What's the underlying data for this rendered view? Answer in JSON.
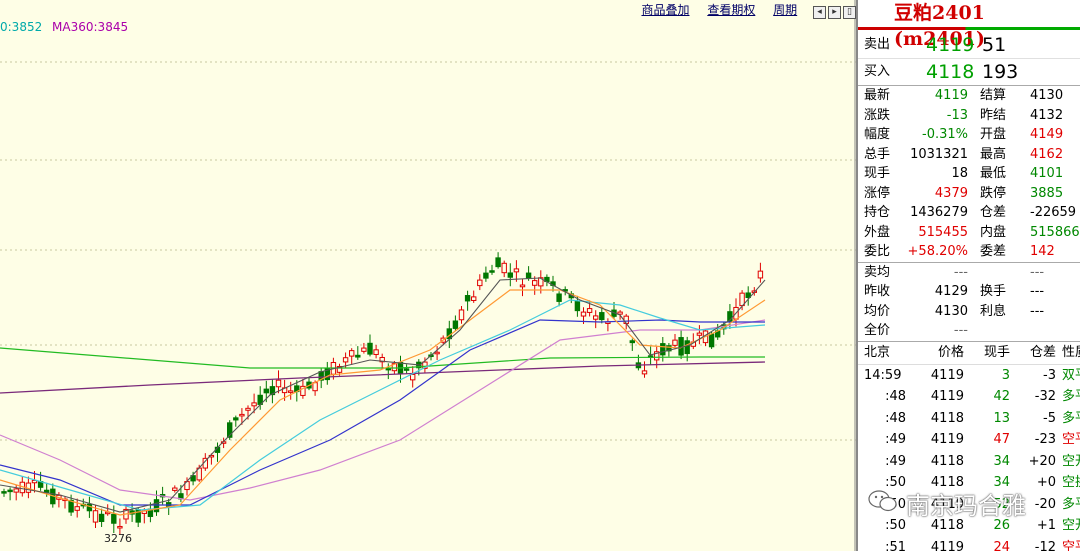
{
  "ma_legend": [
    {
      "text": "0:3852",
      "color": "#00aaaa"
    },
    {
      "text": "MA360:3845",
      "color": "#aa00aa"
    }
  ],
  "toolbar": {
    "overlay_label": "商品叠加",
    "rights_label": "查看期权",
    "period_label": "周期"
  },
  "chart_low_label": "3276",
  "panel": {
    "title": "豆粕2401 (m2401)",
    "sell": {
      "label": "卖出",
      "price": "4119",
      "volume": "51"
    },
    "buy": {
      "label": "买入",
      "price": "4118",
      "volume": "193"
    },
    "stats": [
      {
        "k1": "最新",
        "v1": "4119",
        "c1": "green",
        "k2": "结算",
        "v2": "4130",
        "c2": "black"
      },
      {
        "k1": "涨跌",
        "v1": "-13",
        "c1": "green",
        "k2": "昨结",
        "v2": "4132",
        "c2": "black"
      },
      {
        "k1": "幅度",
        "v1": "-0.31%",
        "c1": "green",
        "k2": "开盘",
        "v2": "4149",
        "c2": "red"
      },
      {
        "k1": "总手",
        "v1": "1031321",
        "c1": "black",
        "k2": "最高",
        "v2": "4162",
        "c2": "red"
      },
      {
        "k1": "现手",
        "v1": "18",
        "c1": "black",
        "k2": "最低",
        "v2": "4101",
        "c2": "green"
      },
      {
        "k1": "涨停",
        "v1": "4379",
        "c1": "red",
        "k2": "跌停",
        "v2": "3885",
        "c2": "green"
      },
      {
        "k1": "持仓",
        "v1": "1436279",
        "c1": "black",
        "k2": "仓差",
        "v2": "-22659",
        "c2": "black"
      },
      {
        "k1": "外盘",
        "v1": "515455",
        "c1": "red",
        "k2": "内盘",
        "v2": "515866",
        "c2": "green"
      },
      {
        "k1": "委比",
        "v1": "+58.20%",
        "c1": "red",
        "k2": "委差",
        "v2": "142",
        "c2": "red"
      }
    ],
    "stats2": [
      {
        "k1": "卖均",
        "v1": "---",
        "c1": "gray",
        "k2": "",
        "v2": "---",
        "c2": "gray"
      },
      {
        "k1": "昨收",
        "v1": "4129",
        "c1": "black",
        "k2": "换手",
        "v2": "---",
        "c2": "black"
      },
      {
        "k1": "均价",
        "v1": "4130",
        "c1": "black",
        "k2": "利息",
        "v2": "---",
        "c2": "black"
      },
      {
        "k1": "全价",
        "v1": "---",
        "c1": "gray",
        "k2": "",
        "v2": "",
        "c2": "black"
      }
    ],
    "tick_header": {
      "time": "北京",
      "price": "价格",
      "vol": "现手",
      "oi": "仓差",
      "nature": "性质"
    },
    "ticks": [
      {
        "time": "14:59",
        "price": "4119",
        "vol": "3",
        "oi": "-3",
        "nature": "双平",
        "vc": "green",
        "nc": "green"
      },
      {
        "time": ":48",
        "price": "4119",
        "vol": "42",
        "oi": "-32",
        "nature": "多平",
        "vc": "green",
        "nc": "green"
      },
      {
        "time": ":48",
        "price": "4118",
        "vol": "13",
        "oi": "-5",
        "nature": "多平",
        "vc": "green",
        "nc": "green"
      },
      {
        "time": ":49",
        "price": "4119",
        "vol": "47",
        "oi": "-23",
        "nature": "空平",
        "vc": "red",
        "nc": "red"
      },
      {
        "time": ":49",
        "price": "4118",
        "vol": "34",
        "oi": "+20",
        "nature": "空开",
        "vc": "green",
        "nc": "green"
      },
      {
        "time": ":50",
        "price": "4118",
        "vol": "34",
        "oi": "+0",
        "nature": "空换",
        "vc": "green",
        "nc": "green"
      },
      {
        "time": ":50",
        "price": "4119",
        "vol": "52",
        "oi": "-20",
        "nature": "多平",
        "vc": "green",
        "nc": "green"
      },
      {
        "time": ":50",
        "price": "4118",
        "vol": "26",
        "oi": "+1",
        "nature": "空开",
        "vc": "green",
        "nc": "green"
      },
      {
        "time": ":51",
        "price": "4119",
        "vol": "24",
        "oi": "-12",
        "nature": "空平",
        "vc": "red",
        "nc": "red"
      }
    ]
  },
  "watermark": "南京玛合雅"
}
